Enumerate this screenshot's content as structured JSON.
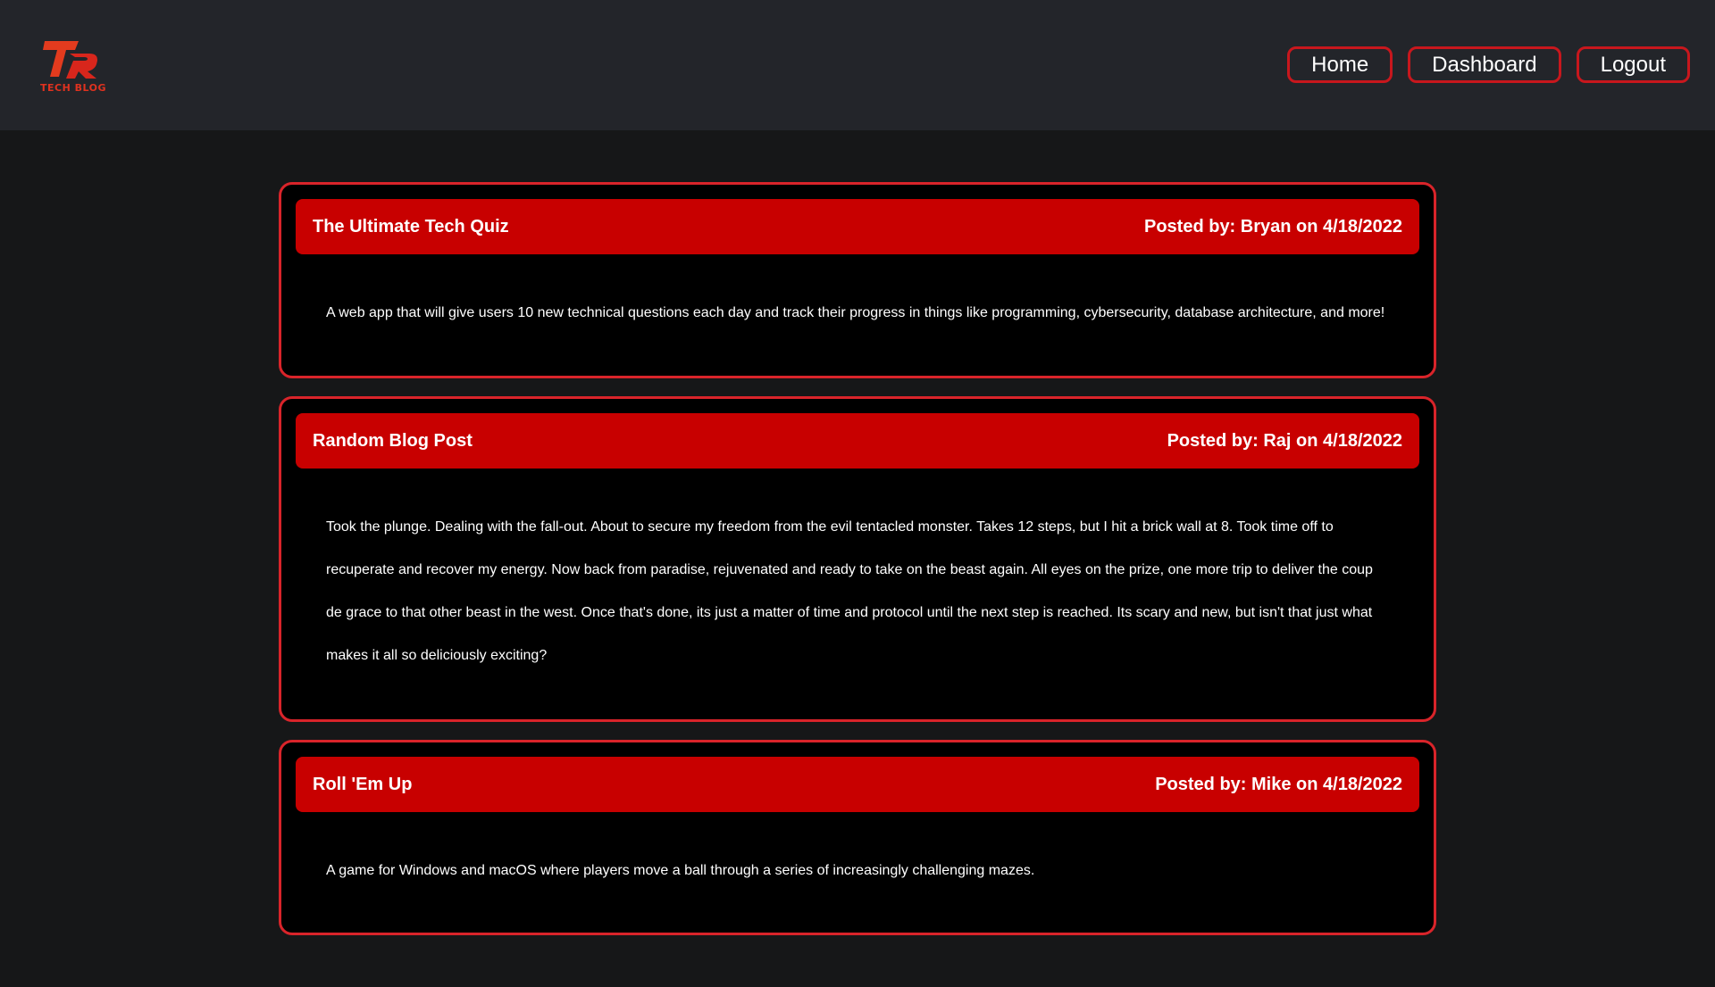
{
  "header": {
    "logo_text": "TECH BLOG",
    "nav": {
      "home": "Home",
      "dashboard": "Dashboard",
      "logout": "Logout"
    }
  },
  "posts": [
    {
      "title": "The Ultimate Tech Quiz",
      "meta": "Posted by: Bryan on 4/18/2022",
      "body": "A web app that will give users 10 new technical questions each day and track their progress in things like programming, cybersecurity, database architecture, and more!"
    },
    {
      "title": "Random Blog Post",
      "meta": "Posted by: Raj on 4/18/2022",
      "body": "Took the plunge. Dealing with the fall-out. About to secure my freedom from the evil tentacled monster. Takes 12 steps, but I hit a brick wall at 8. Took time off to recuperate and recover my energy. Now back from paradise, rejuvenated and ready to take on the beast again. All eyes on the prize, one more trip to deliver the coup de grace to that other beast in the west. Once that's done, its just a matter of time and protocol until the next step is reached. Its scary and new, but isn't that just what makes it all so deliciously exciting?"
    },
    {
      "title": "Roll 'Em Up",
      "meta": "Posted by: Mike on 4/18/2022",
      "body": "A game for Windows and macOS where players move a ball through a series of increasingly challenging mazes."
    }
  ],
  "colors": {
    "accent": "#c80000",
    "border": "#d9242a",
    "header_bg": "#23252a",
    "page_bg": "#161718"
  }
}
